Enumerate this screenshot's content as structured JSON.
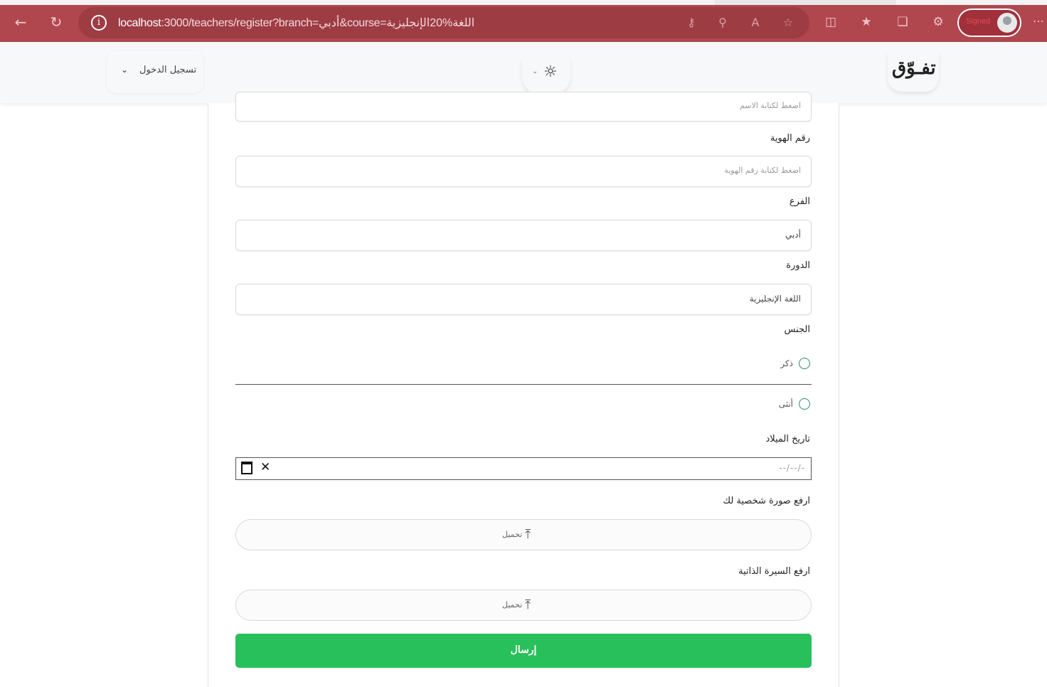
{
  "browser": {
    "url_host": "localhost",
    "url_rest": ":3000/teachers/register?branch=أدبي&course=اللغة%20الإنجليزية",
    "profile_label": "Signed"
  },
  "header": {
    "brand": "تفـوّق",
    "login_label": "تسجيل الدخول"
  },
  "form": {
    "first_field_placeholder": "اضغط لكتابة الاسم",
    "id_label": "رقم الهوية",
    "id_placeholder": "اضغط لكتابة رقم الهوية",
    "branch_label": "الفرع",
    "branch_value": "أدبي",
    "course_label": "الدورة",
    "course_value": "اللغة الإنجليزية",
    "gender_label": "الجنس",
    "gender_options": [
      "ذكر",
      "أنثى"
    ],
    "dob_label": "تاريخ الميلاد",
    "dob_placeholder": "--/--/-",
    "photo_label": "ارفع صورة شخصية لك",
    "cv_label": "ارفع السيرة الذاتية",
    "upload_text": "تحميل",
    "submit_label": "إرسال"
  },
  "colors": {
    "browser_frame": "#b0474f",
    "submit": "#27c05a",
    "radio": "#2c8a6e"
  }
}
